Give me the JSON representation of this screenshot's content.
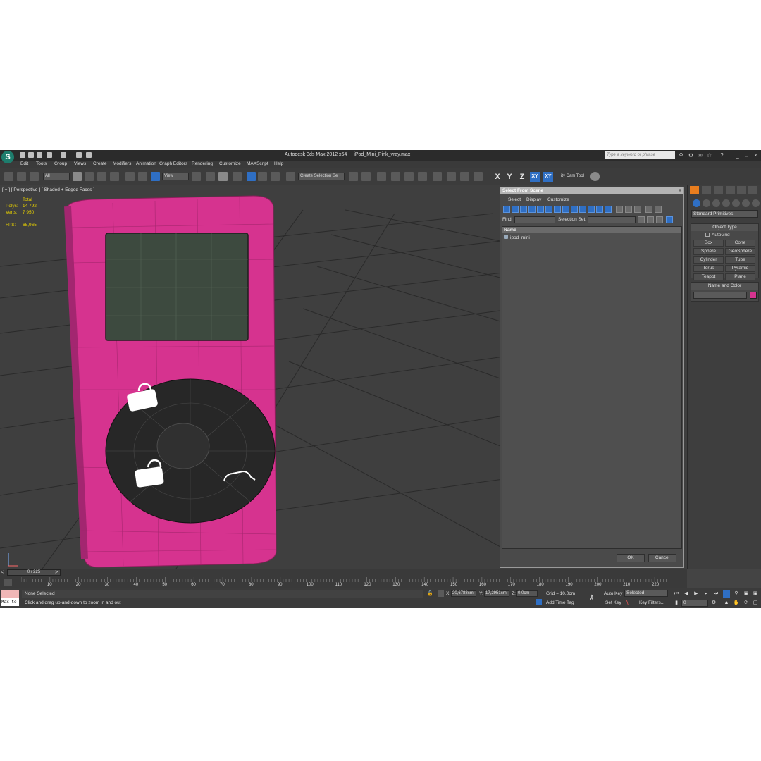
{
  "window": {
    "logo": "S",
    "app_name": "Autodesk 3ds Max  2012 x64",
    "file_name": "iPod_Mini_Pink_vray.max",
    "search_placeholder": "Type a keyword or phrase"
  },
  "menu": [
    "Edit",
    "Tools",
    "Group",
    "Views",
    "Create",
    "Modifiers",
    "Animation",
    "Graph Editors",
    "Rendering",
    "Customize",
    "MAXScript",
    "Help"
  ],
  "toolbar": {
    "filter_value": "All",
    "refcoord_value": "View",
    "named_selection_value": "Create Selection Se",
    "axis_x": "X",
    "axis_y": "Y",
    "axis_z": "Z",
    "axis_xy": "XY",
    "axis_xy2": "XY",
    "cam_tool": "ity Cam Tool"
  },
  "viewport": {
    "label": "[ + ] [ Perspective ] [ Shaded + Edged Faces ]",
    "stats": {
      "total_label": "Total",
      "polys_label": "Polys:",
      "polys_value": "14 792",
      "verts_label": "Verts:",
      "verts_value": "7 950",
      "fps_label": "FPS:",
      "fps_value": "65,965"
    },
    "model_color": "#d6338f"
  },
  "dialog": {
    "title": "Select From Scene",
    "close": "x",
    "menu": [
      "Select",
      "Display",
      "Customize"
    ],
    "find_label": "Find:",
    "selection_set_label": "Selection Set:",
    "column_name": "Name",
    "items": [
      "ipod_mini"
    ],
    "ok": "OK",
    "cancel": "Cancel"
  },
  "command_panel": {
    "dropdown": "Standard Primitives",
    "object_type_title": "Object Type",
    "autogrid": "AutoGrid",
    "primitives": [
      "Box",
      "Cone",
      "Sphere",
      "GeoSphere",
      "Cylinder",
      "Tube",
      "Torus",
      "Pyramid",
      "Teapot",
      "Plane"
    ],
    "name_color_title": "Name and Color",
    "object_color": "#d6338f"
  },
  "timeline": {
    "slider": "0 / 225",
    "ticks": [
      "10",
      "20",
      "30",
      "40",
      "50",
      "60",
      "70",
      "80",
      "90",
      "100",
      "110",
      "120",
      "130",
      "140",
      "150",
      "160",
      "170",
      "180",
      "190",
      "200",
      "210",
      "220"
    ]
  },
  "status": {
    "maxscript_text": "Max to",
    "selection": "None Selected",
    "prompt": "Click and drag up-and-down to zoom in and out",
    "x_label": "X:",
    "x_value": "20,6788cm",
    "y_label": "Y:",
    "y_value": "17,2951cm",
    "z_label": "Z:",
    "z_value": "0,0cm",
    "grid": "Grid = 10,0cm",
    "add_time_tag": "Add Time Tag",
    "auto_key": "Auto Key",
    "auto_key_value": "Selected",
    "set_key": "Set Key",
    "key_filters": "Key Filters...",
    "frame_value": "0"
  }
}
